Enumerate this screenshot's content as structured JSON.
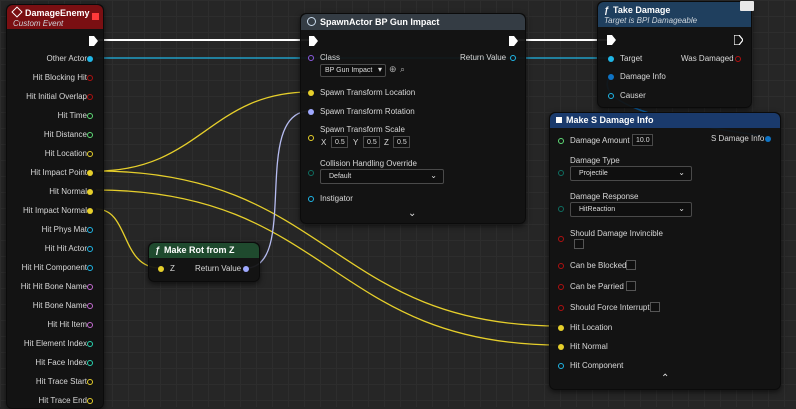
{
  "colors": {
    "event_header": "#7a0f12",
    "function_header": "#1f3f5e",
    "spawn_header": "#343c44",
    "pin_struct": "#0e73c4",
    "pin_vector": "#e6cf2b",
    "pin_rotator": "#9fa9ff",
    "pin_float": "#5fdb77",
    "pin_name": "#c46bd1",
    "pin_bool": "#8a1010",
    "pin_object": "#1fb6e6",
    "pin_int": "#29d4b0",
    "pin_byte": "#0f6e61",
    "wire_exec": "#ffffff",
    "wire_vector": "#e6cf2b",
    "wire_rotator": "#b7bdf2",
    "wire_object": "#1fb6e6"
  },
  "damage_enemy": {
    "title": "DamageEnemy",
    "subtitle": "Custom Event",
    "pins": [
      "Other Actor",
      "Hit Blocking Hit",
      "Hit Initial Overlap",
      "Hit Time",
      "Hit Distance",
      "Hit Location",
      "Hit Impact Point",
      "Hit Normal",
      "Hit Impact Normal",
      "Hit Phys Mat",
      "Hit Hit Actor",
      "Hit Hit Component",
      "Hit Hit Bone Name",
      "Hit Bone Name",
      "Hit Hit Item",
      "Hit Element Index",
      "Hit Face Index",
      "Hit Trace Start",
      "Hit Trace End"
    ]
  },
  "spawn_actor": {
    "title": "SpawnActor BP Gun Impact",
    "class_label": "Class",
    "class_value": "BP Gun Impact",
    "return_value": "Return Value",
    "loc": "Spawn Transform Location",
    "rot": "Spawn Transform Rotation",
    "scale": "Spawn Transform Scale",
    "x_label": "X",
    "x": "0.5",
    "y_label": "Y",
    "y": "0.5",
    "z_label": "Z",
    "z": "0.5",
    "collision": "Collision Handling Override",
    "collision_value": "Default",
    "instigator": "Instigator"
  },
  "take_damage": {
    "title": "Take Damage",
    "subtitle": "Target is BPI Damageable",
    "target": "Target",
    "damage_info": "Damage Info",
    "causer": "Causer",
    "was_damaged": "Was Damaged"
  },
  "make_rot": {
    "title": "Make Rot from Z",
    "z": "Z",
    "return_value": "Return Value"
  },
  "make_damage_info": {
    "title": "Make S Damage Info",
    "amount_label": "Damage Amount",
    "amount_value": "10.0",
    "output": "S Damage Info",
    "type_label": "Damage Type",
    "type_value": "Projectile",
    "response_label": "Damage Response",
    "response_value": "HitReaction",
    "invincible": "Should Damage Invincible",
    "blocked": "Can be Blocked",
    "parried": "Can be Parried",
    "interrupt": "Should Force Interrupt",
    "hit_location": "Hit Location",
    "hit_normal": "Hit Normal",
    "hit_component": "Hit Component"
  }
}
